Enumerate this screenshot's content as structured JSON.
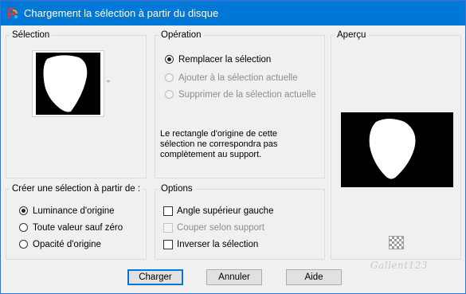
{
  "window": {
    "title": "Chargement la sélection à partir du disque"
  },
  "selection_group": {
    "legend": "Sélection"
  },
  "operation_group": {
    "legend": "Opération",
    "options": [
      {
        "label": "Remplacer la sélection",
        "checked": true,
        "enabled": true
      },
      {
        "label": "Ajouter à la sélection actuelle",
        "checked": false,
        "enabled": false
      },
      {
        "label": "Supprimer de la sélection actuelle",
        "checked": false,
        "enabled": false
      }
    ],
    "message_line1": "Le rectangle d'origine de cette",
    "message_line2": "sélection ne correspondra pas",
    "message_line3": "complètement au support."
  },
  "preview_group": {
    "legend": "Aperçu"
  },
  "create_group": {
    "legend": "Créer une sélection à partir de :",
    "options": [
      {
        "label": "Luminance d'origine",
        "checked": true
      },
      {
        "label": "Toute valeur sauf zéro",
        "checked": false
      },
      {
        "label": "Opacité d'origine",
        "checked": false
      }
    ]
  },
  "options_group": {
    "legend": "Options",
    "items": [
      {
        "label": "Angle supérieur gauche",
        "checked": false,
        "enabled": true
      },
      {
        "label": "Couper selon support",
        "checked": false,
        "enabled": false
      },
      {
        "label": "Inverser la sélection",
        "checked": false,
        "enabled": true
      }
    ]
  },
  "buttons": {
    "ok": "Charger",
    "cancel": "Annuler",
    "help": "Aide"
  },
  "watermark": "Gallent123",
  "colors": {
    "titlebar": "#0078d7",
    "accent": "#0078d7",
    "background": "#f0f0f0"
  }
}
